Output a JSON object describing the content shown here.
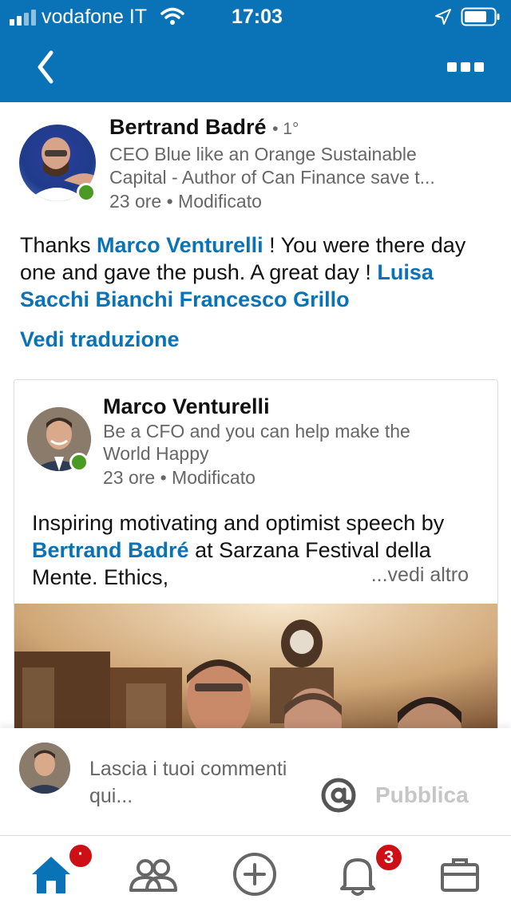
{
  "status_bar": {
    "carrier": "vodafone IT",
    "time": "17:03"
  },
  "header": {
    "back_icon": "chevron-left-icon",
    "more_icon": "more-dots-icon"
  },
  "post": {
    "author": {
      "name": "Bertrand Badré",
      "degree": "• 1°",
      "headline_line1": "CEO Blue like an Orange Sustainable",
      "headline_line2": "Capital - Author of Can Finance save t...",
      "time": "23 ore • Modificato"
    },
    "text": {
      "part1": "Thanks ",
      "mention1": "Marco Venturelli",
      "part2": " ! You were there day one and gave the push. A great day ! ",
      "mention2": "Luisa Sacchi Bianchi",
      "part3": " ",
      "mention3": "Francesco Grillo"
    },
    "translate_label": "Vedi traduzione",
    "shared": {
      "name": "Marco Venturelli",
      "headline_line1": "Be a CFO and you can help make the",
      "headline_line2": "World Happy",
      "time": "23 ore • Modificato",
      "text_part1": "Inspiring motivating and optimist speech by ",
      "mention": "Bertrand Badré",
      "text_part2": " at Sarzana Festival della Mente. Ethics,",
      "see_more": "...vedi altro"
    }
  },
  "comment_bar": {
    "placeholder": "Lascia i tuoi commenti qui...",
    "mention_icon": "at-icon",
    "publish_label": "Pubblica"
  },
  "bottom_nav": {
    "items": [
      {
        "icon": "home-icon",
        "badge": "·"
      },
      {
        "icon": "network-icon"
      },
      {
        "icon": "add-post-icon"
      },
      {
        "icon": "notifications-icon",
        "badge": "3"
      },
      {
        "icon": "jobs-icon"
      }
    ]
  },
  "colors": {
    "brand": "#0a73b8",
    "online": "#4a9a24",
    "badge": "#cc1016"
  }
}
